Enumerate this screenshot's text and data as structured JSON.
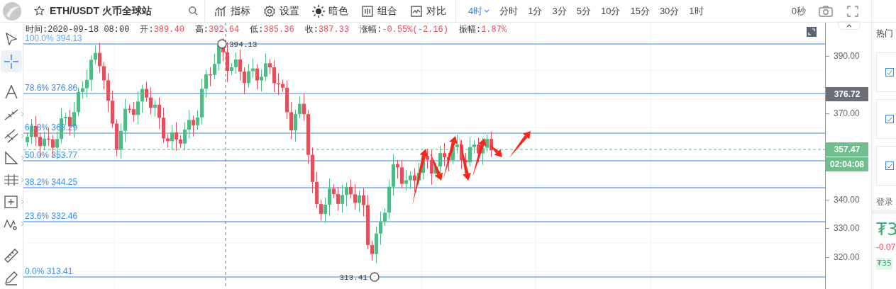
{
  "header": {
    "title": "ETH/USDT 火币全球站",
    "menu": [
      {
        "label": "指标"
      },
      {
        "label": "设置"
      },
      {
        "label": "暗色"
      },
      {
        "label": "组合"
      },
      {
        "label": "对比"
      }
    ],
    "intervals": [
      {
        "label": "4时",
        "selected": true
      },
      {
        "label": "分时",
        "selected": false
      },
      {
        "label": "1分",
        "selected": false
      },
      {
        "label": "3分",
        "selected": false
      },
      {
        "label": "5分",
        "selected": false
      },
      {
        "label": "10分",
        "selected": false
      },
      {
        "label": "15分",
        "selected": false
      },
      {
        "label": "30分",
        "selected": false
      },
      {
        "label": "1时",
        "selected": false
      }
    ],
    "countdown": "0秒"
  },
  "tools": [
    {
      "selected": false,
      "submenu": false
    },
    {
      "selected": true,
      "submenu": false
    },
    {
      "selected": false,
      "submenu": false
    },
    {
      "selected": false,
      "submenu": true
    },
    {
      "selected": false,
      "submenu": true
    },
    {
      "selected": false,
      "submenu": true
    },
    {
      "selected": false,
      "submenu": true
    },
    {
      "selected": false,
      "submenu": true
    },
    {
      "selected": false,
      "submenu": true
    },
    {
      "selected": false,
      "submenu": false
    },
    {
      "selected": false,
      "submenu": false
    }
  ],
  "info": [
    {
      "label": "时间:",
      "value": "2020-09-18 08:00",
      "color": "#333333"
    },
    {
      "label": "开:",
      "value": "389.40",
      "color": "#e3505d"
    },
    {
      "label": "高:",
      "value": "392.64",
      "color": "#e3505d"
    },
    {
      "label": "低:",
      "value": "385.36",
      "color": "#e3505d"
    },
    {
      "label": "收:",
      "value": "387.33",
      "color": "#e3505d"
    },
    {
      "label": "涨幅:",
      "value": "-0.55%(-2.16)",
      "color": "#e3505d"
    },
    {
      "label": "振幅:",
      "value": "1.87%",
      "color": "#e3505d"
    }
  ],
  "fib_levels": [
    {
      "label": "100.0% 394.13"
    },
    {
      "label": "78.6% 376.86"
    },
    {
      "label": "61.8% 363.29"
    },
    {
      "label": "50.0% 353.77"
    },
    {
      "label": "38.2% 344.25"
    },
    {
      "label": "23.6% 332.46"
    },
    {
      "label": "0.0% 313.41"
    }
  ],
  "marked_points": [
    {
      "text": "394.13"
    },
    {
      "text": "313.41"
    }
  ],
  "price_axis": [
    "390.00",
    "370.00",
    "340.00",
    "330.00",
    "320.00"
  ],
  "axis_tags": [
    {
      "text": "376.72",
      "kind": "crosshair"
    },
    {
      "text": "357.47",
      "kind": "last"
    },
    {
      "text": "02:04:08",
      "kind": "countdown"
    }
  ],
  "side_panel": {
    "heading": "热门",
    "cards": [
      {
        "checked": true
      },
      {
        "checked": true
      },
      {
        "checked": true
      }
    ],
    "login": "登录",
    "price": "₮3",
    "change": "-0.07",
    "tag": "₮35"
  }
}
